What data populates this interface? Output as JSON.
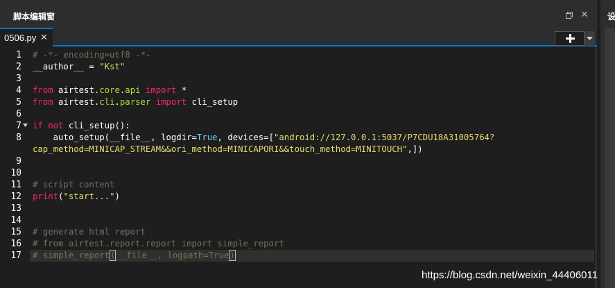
{
  "panel": {
    "title": "脚本编辑窗",
    "right_panel_title": "设"
  },
  "tab": {
    "filename": "0506.py",
    "close_glyph": "✕"
  },
  "toolbar": {
    "add_icon": "plus-icon",
    "dropdown_icon": "chevron-down-icon"
  },
  "editor": {
    "line_numbers": [
      "1",
      "2",
      "3",
      "4",
      "5",
      "6",
      "7",
      "8",
      "9",
      "10",
      "11",
      "12",
      "13",
      "14",
      "15",
      "16",
      "17"
    ],
    "lines": {
      "l1": [
        {
          "t": "# -*- encoding=utf8 -*-",
          "c": "cmt"
        }
      ],
      "l2": [
        {
          "t": "__author__ = ",
          "c": ""
        },
        {
          "t": "\"Kst\"",
          "c": "str"
        }
      ],
      "l4": [
        {
          "t": "from",
          "c": "kw"
        },
        {
          "t": " airtest.",
          "c": ""
        },
        {
          "t": "core",
          "c": "fn"
        },
        {
          "t": ".",
          "c": ""
        },
        {
          "t": "api",
          "c": "fn"
        },
        {
          "t": " ",
          "c": ""
        },
        {
          "t": "import",
          "c": "kw"
        },
        {
          "t": " *",
          "c": ""
        }
      ],
      "l5": [
        {
          "t": "from",
          "c": "kw"
        },
        {
          "t": " airtest.",
          "c": ""
        },
        {
          "t": "cli",
          "c": "fn"
        },
        {
          "t": ".",
          "c": ""
        },
        {
          "t": "parser",
          "c": "fn"
        },
        {
          "t": " ",
          "c": ""
        },
        {
          "t": "import",
          "c": "kw"
        },
        {
          "t": " cli_setup",
          "c": ""
        }
      ],
      "l7": [
        {
          "t": "if",
          "c": "kw"
        },
        {
          "t": " ",
          "c": ""
        },
        {
          "t": "not",
          "c": "kw"
        },
        {
          "t": " cli_setup():",
          "c": ""
        }
      ],
      "l8a": [
        {
          "t": "    auto_setup(__file__, logdir=",
          "c": ""
        },
        {
          "t": "True",
          "c": "blt"
        },
        {
          "t": ", devices=[",
          "c": ""
        },
        {
          "t": "\"android://127.0.0.1:5037/P7CDU18A31005764?",
          "c": "str"
        }
      ],
      "l8b": [
        {
          "t": "cap_method=MINICAP_STREAM&&ori_method=MINICAPORI&&touch_method=MINITOUCH\"",
          "c": "str"
        },
        {
          "t": ",])",
          "c": ""
        }
      ],
      "l11": [
        {
          "t": "# script content",
          "c": "cmt"
        }
      ],
      "l12": [
        {
          "t": "print",
          "c": "kw"
        },
        {
          "t": "(",
          "c": ""
        },
        {
          "t": "\"start...\"",
          "c": "str"
        },
        {
          "t": ")",
          "c": ""
        }
      ],
      "l15": [
        {
          "t": "# generate html report",
          "c": "cmt"
        }
      ],
      "l16": [
        {
          "t": "# from airtest.report.report import simple_report",
          "c": "cmt"
        }
      ],
      "l17": [
        {
          "t": "# simple_report",
          "c": "cmt"
        },
        {
          "t": "(",
          "c": "cmt bkt"
        },
        {
          "t": "__file__, logpath=True",
          "c": "cmt"
        },
        {
          "t": ")",
          "c": "cmt bkt"
        }
      ]
    }
  },
  "watermark": "https://blog.csdn.net/weixin_44406011"
}
